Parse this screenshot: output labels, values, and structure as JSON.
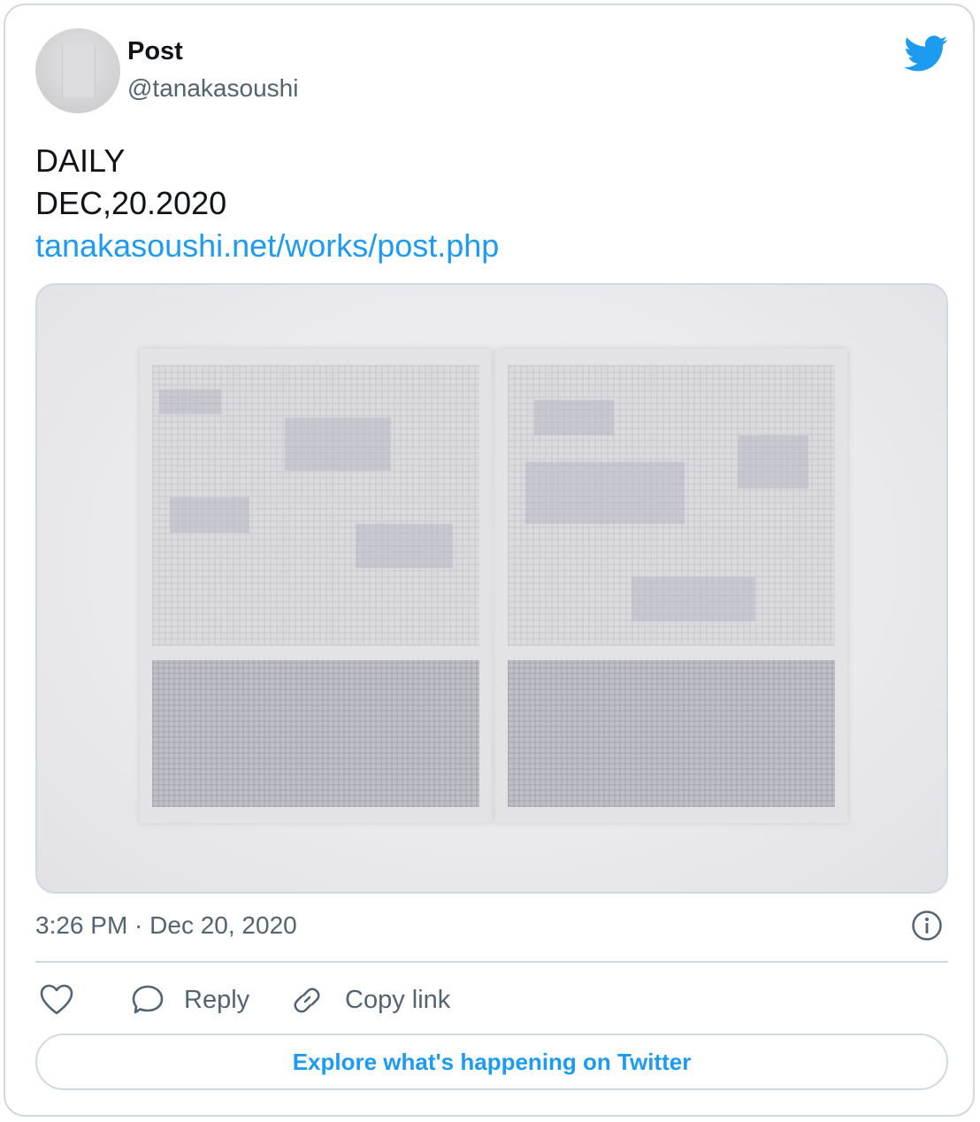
{
  "author": {
    "display_name": "Post",
    "handle": "@tanakasoushi"
  },
  "tweet": {
    "lines": [
      "DAILY",
      "DEC,20.2020"
    ],
    "link_text": "tanakasoushi.net/works/post.php",
    "timestamp": "3:26 PM · Dec 20, 2020"
  },
  "actions": {
    "reply_label": "Reply",
    "copy_link_label": "Copy link"
  },
  "explore_button": {
    "label": "Explore what's happening on Twitter"
  },
  "icons": {
    "brand": "twitter-bird-icon",
    "like": "heart-icon",
    "reply": "speech-bubble-icon",
    "copy": "link-icon",
    "info": "info-icon"
  },
  "colors": {
    "accent": "#1d9bf0",
    "text_primary": "#0f1419",
    "text_secondary": "#536471",
    "border": "#cfd9de"
  }
}
